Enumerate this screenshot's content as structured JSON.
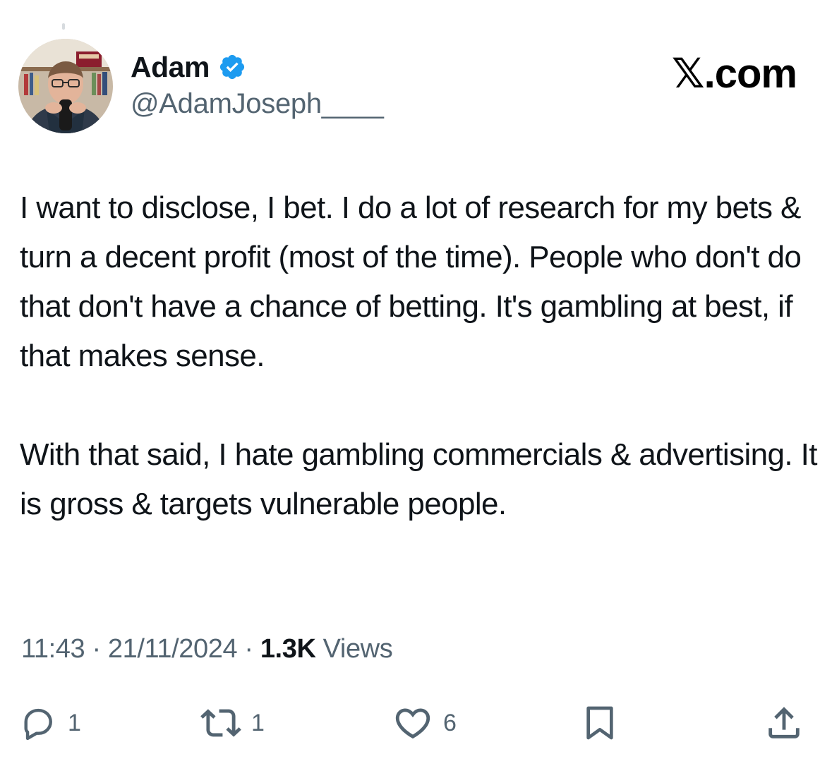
{
  "author": {
    "display_name": "Adam",
    "handle": "@AdamJoseph____",
    "verified": true,
    "avatar_icon": "profile-photo"
  },
  "brand": {
    "label": "𝕏.com"
  },
  "tweet": {
    "paragraphs": [
      "I want to disclose, I bet. I do a lot of research for my bets & turn a decent profit (most of the time). People who don't do that don't have a chance of betting. It's gambling at best, if that makes sense.",
      "With that said, I hate gambling commercials & advertising. It is gross & targets vulnerable people."
    ]
  },
  "meta": {
    "time": "11:43",
    "separator": " · ",
    "date": "21/11/2024",
    "views_count": "1.3K",
    "views_label": " Views"
  },
  "actions": {
    "reply": {
      "icon": "reply-icon",
      "count": "1"
    },
    "repost": {
      "icon": "repost-icon",
      "count": "1"
    },
    "like": {
      "icon": "heart-icon",
      "count": "6"
    },
    "bookmark": {
      "icon": "bookmark-icon"
    },
    "share": {
      "icon": "share-icon"
    }
  },
  "colors": {
    "text": "#0f1419",
    "muted": "#536471",
    "verified": "#1d9bf0",
    "background": "#ffffff"
  }
}
